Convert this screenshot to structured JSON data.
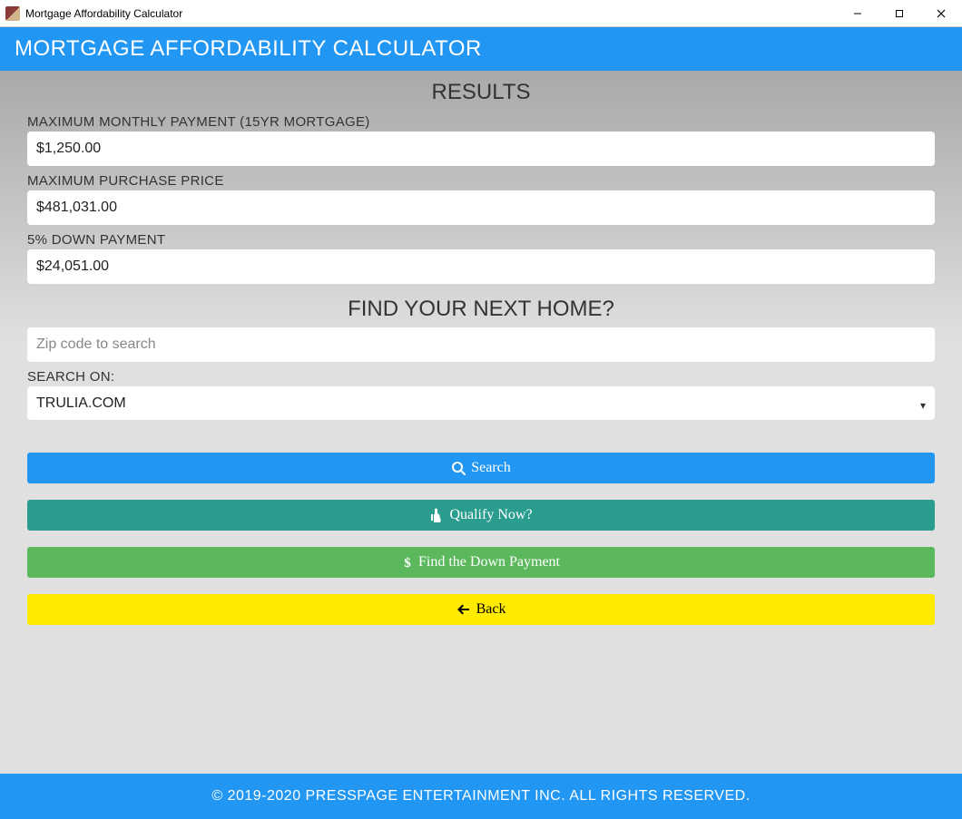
{
  "window": {
    "title": "Mortgage Affordability Calculator"
  },
  "header": {
    "title": "MORTGAGE AFFORDABILITY CALCULATOR"
  },
  "results": {
    "heading": "RESULTS",
    "max_monthly_label": "MAXIMUM MONTHLY PAYMENT (15YR MORTGAGE)",
    "max_monthly_value": "$1,250.00",
    "max_purchase_label": "MAXIMUM PURCHASE PRICE",
    "max_purchase_value": "$481,031.00",
    "down_payment_label": "5% DOWN PAYMENT",
    "down_payment_value": "$24,051.00"
  },
  "find_home": {
    "heading": "FIND YOUR NEXT HOME?",
    "zip_placeholder": "Zip code to search",
    "zip_value": "",
    "search_on_label": "SEARCH ON:",
    "search_on_value": "TRULIA.COM"
  },
  "buttons": {
    "search": "Search",
    "qualify": "Qualify Now?",
    "find_down": "Find the Down Payment",
    "back": "Back"
  },
  "footer": {
    "text": "© 2019-2020 PRESSPAGE ENTERTAINMENT INC. ALL RIGHTS RESERVED."
  }
}
